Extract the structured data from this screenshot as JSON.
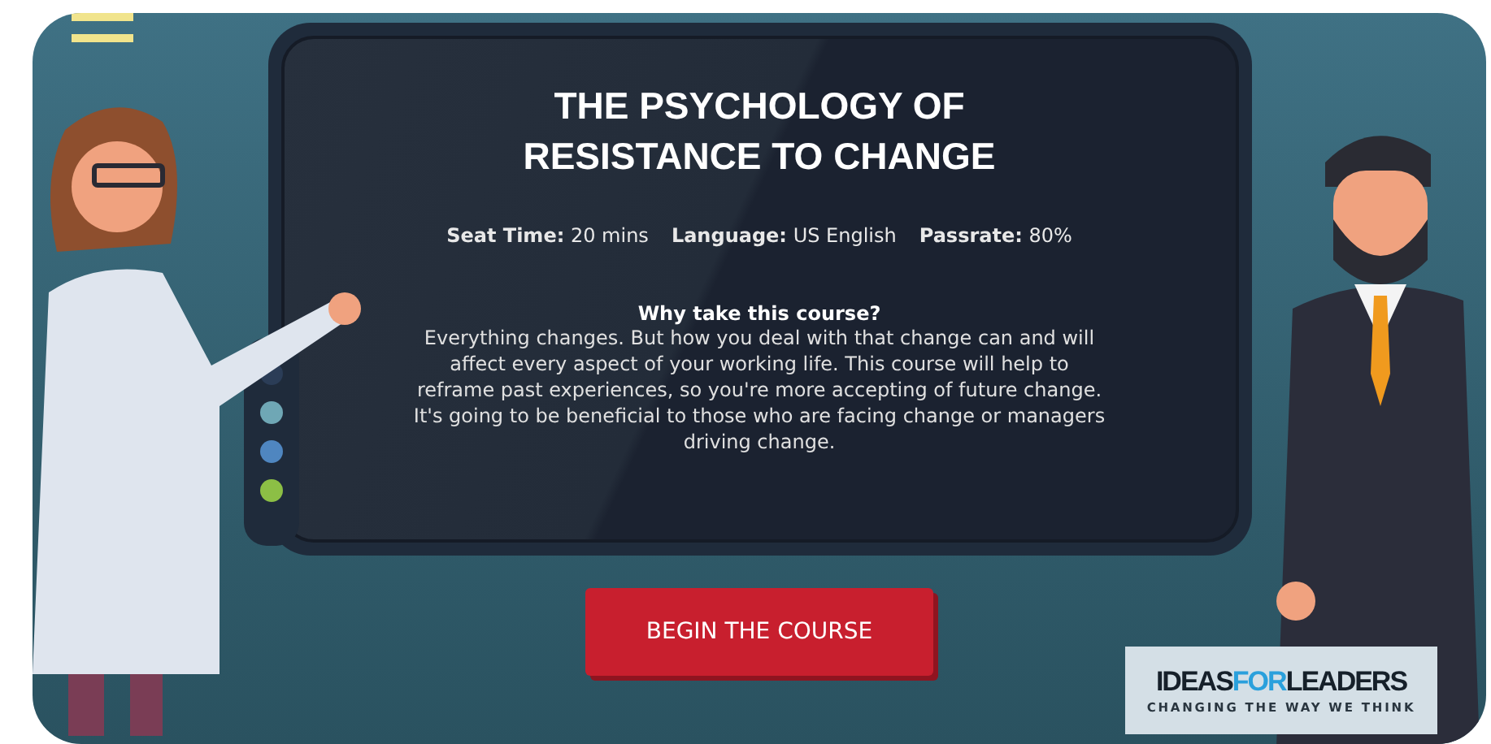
{
  "course": {
    "title": "THE PSYCHOLOGY OF RESISTANCE TO CHANGE",
    "meta": [
      {
        "label": "Seat Time:",
        "value": "20 mins"
      },
      {
        "label": "Language:",
        "value": "US English"
      },
      {
        "label": "Passrate:",
        "value": "80%"
      }
    ],
    "why_heading": "Why take this course?",
    "description": "Everything changes. But how you deal with that change can and will affect every aspect of your working life. This course will help to reframe past experiences, so you're more accepting of future change. It's going to be beneficial to those who are facing change or managers driving change.",
    "start_button": "BEGIN THE COURSE"
  },
  "device_lights": [
    {
      "color": "#2b3d57"
    },
    {
      "color": "#6fa7b5"
    },
    {
      "color": "#4f86c0"
    },
    {
      "color": "#8cbf45"
    }
  ],
  "logo": {
    "words": [
      {
        "text": "IDEAS",
        "kind": "dark"
      },
      {
        "text": "FOR",
        "kind": "accent"
      },
      {
        "text": "LEADERS",
        "kind": "dark"
      }
    ],
    "tagline": "CHANGING THE WAY WE THINK"
  }
}
